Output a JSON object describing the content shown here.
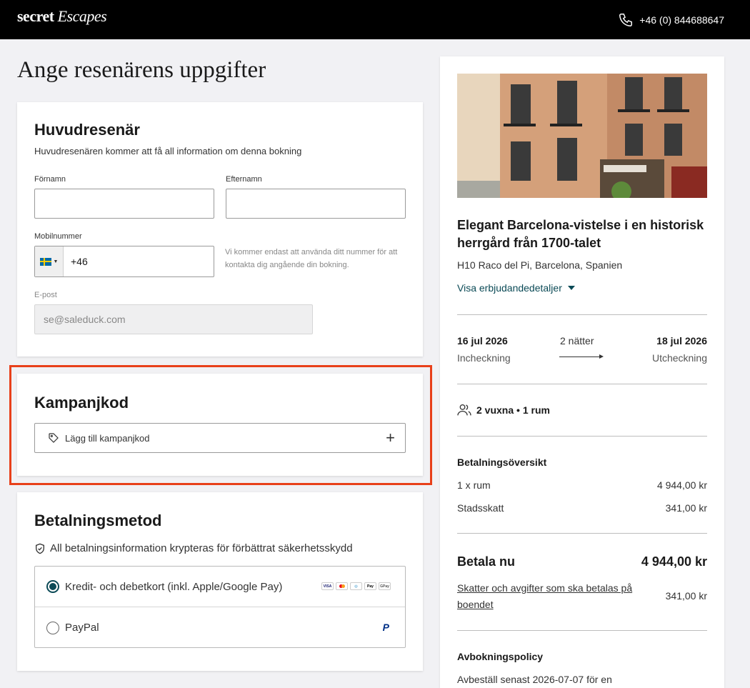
{
  "header": {
    "logo_secret": "secret",
    "logo_escapes": "Escapes",
    "phone": "+46 (0) 844688647"
  },
  "page_title": "Ange resenärens uppgifter",
  "traveller": {
    "heading": "Huvudresenär",
    "subtitle": "Huvudresenären kommer att få all information om denna bokning",
    "first_name_label": "Förnamn",
    "first_name_value": "",
    "last_name_label": "Efternamn",
    "last_name_value": "",
    "mobile_label": "Mobilnummer",
    "mobile_prefix": "+46",
    "mobile_hint": "Vi kommer endast att använda ditt nummer för att kontakta dig angående din bokning.",
    "email_label": "E-post",
    "email_value": "se@saleduck.com"
  },
  "promo": {
    "heading": "Kampanjkod",
    "add_label": "Lägg till kampanjkod"
  },
  "payment": {
    "heading": "Betalningsmetod",
    "secure_note": "All betalningsinformation krypteras för förbättrat säkerhetsskydd",
    "options": [
      {
        "label": "Kredit- och debetkort (inkl. Apple/Google Pay)",
        "selected": true
      },
      {
        "label": "PayPal",
        "selected": false
      }
    ]
  },
  "summary": {
    "title": "Elegant Barcelona-vistelse i en historisk herrgård från 1700-talet",
    "location": "H10 Raco del Pi, Barcelona, Spanien",
    "details_link": "Visa erbjudandedetaljer",
    "checkin_date": "16 jul 2026",
    "checkin_label": "Incheckning",
    "nights": "2 nätter",
    "checkout_date": "18 jul 2026",
    "checkout_label": "Utcheckning",
    "guests": "2 vuxna • 1 rum",
    "overview_heading": "Betalningsöversikt",
    "room_label": "1 x rum",
    "room_price": "4 944,00 kr",
    "tax_label": "Stadsskatt",
    "tax_price": "341,00 kr",
    "pay_now_label": "Betala nu",
    "pay_now_price": "4 944,00 kr",
    "taxes_link": "Skatter och avgifter som ska betalas på boendet",
    "taxes_price": "341,00 kr",
    "cancel_heading": "Avbokningspolicy",
    "cancel_text": "Avbeställ senast 2026-07-07 för en"
  },
  "colors": {
    "accent": "#0b4a56",
    "highlight": "#e8401a",
    "header_bg": "#000000"
  }
}
